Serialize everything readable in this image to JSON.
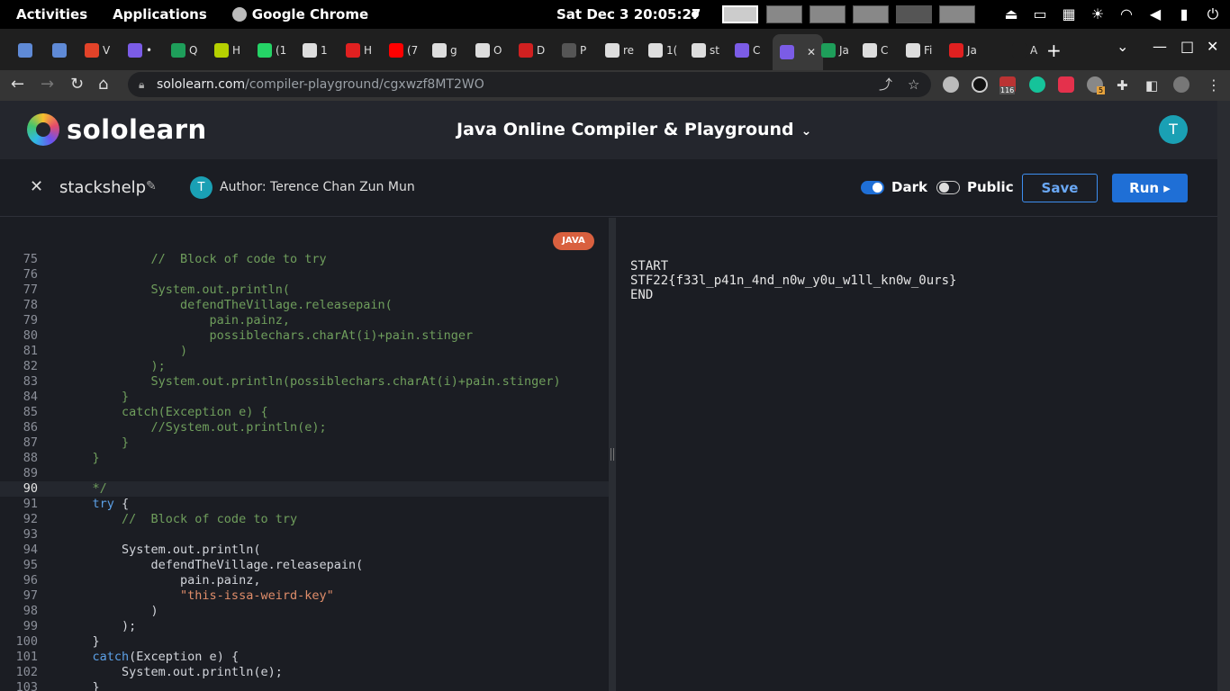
{
  "topbar": {
    "activities": "Activities",
    "applications": "Applications",
    "app_name": "Google Chrome",
    "clock": "Sat Dec 3  20:05:27"
  },
  "tabs": [
    {
      "label": "",
      "color": "#5f8ad6"
    },
    {
      "label": "",
      "color": "#5f8ad6"
    },
    {
      "label": "V",
      "color": "#e24329"
    },
    {
      "label": "•",
      "color": "#7b5ce6"
    },
    {
      "label": "Q",
      "color": "#1e9e5a"
    },
    {
      "label": "H",
      "color": "#b5d000"
    },
    {
      "label": "(1",
      "color": "#25d366"
    },
    {
      "label": "1",
      "color": "#ddd"
    },
    {
      "label": "H",
      "color": "#e02020"
    },
    {
      "label": "(7",
      "color": "#ff0000"
    },
    {
      "label": "g",
      "color": "#ddd"
    },
    {
      "label": "O",
      "color": "#ddd"
    },
    {
      "label": "D",
      "color": "#d02020"
    },
    {
      "label": "P",
      "color": "#555"
    },
    {
      "label": "re",
      "color": "#ddd"
    },
    {
      "label": "1(",
      "color": "#ddd"
    },
    {
      "label": "st",
      "color": "#ddd"
    },
    {
      "label": "C",
      "color": "#7b5ce6"
    },
    {
      "label": "",
      "color": "#7b5ce6"
    },
    {
      "label": "Ja",
      "color": "#1e9e5a"
    },
    {
      "label": "C",
      "color": "#ddd"
    },
    {
      "label": "Fi",
      "color": "#ddd"
    },
    {
      "label": "Ja",
      "color": "#e02020"
    },
    {
      "label": "A",
      "color": "#1f1f1f"
    }
  ],
  "address_bar": {
    "domain": "sololearn.com",
    "path": "/compiler-playground/cgxwzf8MT2WO"
  },
  "extensions": {
    "badge_1": "116",
    "badge_2": "5"
  },
  "header": {
    "logo_text": "sololearn",
    "title": "Java Online Compiler & Playground",
    "avatar_initial": "T"
  },
  "project": {
    "name": "stackshelp",
    "author_initial": "T",
    "author": "Author: Terence Chan Zun Mun",
    "dark_label": "Dark",
    "dark_on": true,
    "public_label": "Public",
    "public_on": false,
    "save_label": "Save",
    "run_label": "Run ▸"
  },
  "editor": {
    "language_badge": "JAVA",
    "current_line": 90,
    "lines": [
      {
        "n": "75",
        "tokens": [
          [
            "cm",
            "            //  Block of code to try"
          ]
        ]
      },
      {
        "n": "76",
        "tokens": [
          [
            "pl",
            ""
          ]
        ]
      },
      {
        "n": "77",
        "tokens": [
          [
            "cm",
            "            System.out.println("
          ]
        ]
      },
      {
        "n": "78",
        "tokens": [
          [
            "cm",
            "                defendTheVillage.releasepain("
          ]
        ]
      },
      {
        "n": "79",
        "tokens": [
          [
            "cm",
            "                    pain.painz,"
          ]
        ]
      },
      {
        "n": "80",
        "tokens": [
          [
            "cm",
            "                    possiblechars.charAt(i)+pain.stinger"
          ]
        ]
      },
      {
        "n": "81",
        "tokens": [
          [
            "cm",
            "                )"
          ]
        ]
      },
      {
        "n": "82",
        "tokens": [
          [
            "cm",
            "            );"
          ]
        ]
      },
      {
        "n": "83",
        "tokens": [
          [
            "cm",
            "            System.out.println(possiblechars.charAt(i)+pain.stinger)"
          ]
        ]
      },
      {
        "n": "84",
        "tokens": [
          [
            "cm",
            "        }"
          ]
        ]
      },
      {
        "n": "85",
        "tokens": [
          [
            "cm",
            "        catch(Exception e) {"
          ]
        ]
      },
      {
        "n": "86",
        "tokens": [
          [
            "cm",
            "            //System.out.println(e);"
          ]
        ]
      },
      {
        "n": "87",
        "tokens": [
          [
            "cm",
            "        }"
          ]
        ]
      },
      {
        "n": "88",
        "tokens": [
          [
            "cm",
            "    }"
          ]
        ]
      },
      {
        "n": "89",
        "tokens": [
          [
            "pl",
            ""
          ]
        ]
      },
      {
        "n": "90",
        "tokens": [
          [
            "cm",
            "    */"
          ]
        ]
      },
      {
        "n": "91",
        "tokens": [
          [
            "kw",
            "    try"
          ],
          [
            "pl",
            " {"
          ]
        ]
      },
      {
        "n": "92",
        "tokens": [
          [
            "cm",
            "        //  Block of code to try"
          ]
        ]
      },
      {
        "n": "93",
        "tokens": [
          [
            "pl",
            ""
          ]
        ]
      },
      {
        "n": "94",
        "tokens": [
          [
            "pl",
            "        System.out.println("
          ]
        ]
      },
      {
        "n": "95",
        "tokens": [
          [
            "pl",
            "            defendTheVillage.releasepain("
          ]
        ]
      },
      {
        "n": "96",
        "tokens": [
          [
            "pl",
            "                pain.painz,"
          ]
        ]
      },
      {
        "n": "97",
        "tokens": [
          [
            "st",
            "                \"this-issa-weird-key\""
          ]
        ]
      },
      {
        "n": "98",
        "tokens": [
          [
            "pl",
            "            )"
          ]
        ]
      },
      {
        "n": "99",
        "tokens": [
          [
            "pl",
            "        );"
          ]
        ]
      },
      {
        "n": "100",
        "tokens": [
          [
            "pl",
            "    }"
          ]
        ]
      },
      {
        "n": "101",
        "tokens": [
          [
            "kw",
            "    catch"
          ],
          [
            "pl",
            "(Exception e) {"
          ]
        ]
      },
      {
        "n": "102",
        "tokens": [
          [
            "pl",
            "        System.out.println(e);"
          ]
        ]
      },
      {
        "n": "103",
        "tokens": [
          [
            "pl",
            "    }"
          ]
        ]
      }
    ]
  },
  "output": {
    "lines": [
      "START",
      "STF22{f33l_p41n_4nd_n0w_y0u_w1ll_kn0w_0urs}",
      "END"
    ]
  },
  "colors": {
    "accent": "#1f6fd6",
    "badge": "#d9603f",
    "avatar": "#1aa0b4"
  }
}
